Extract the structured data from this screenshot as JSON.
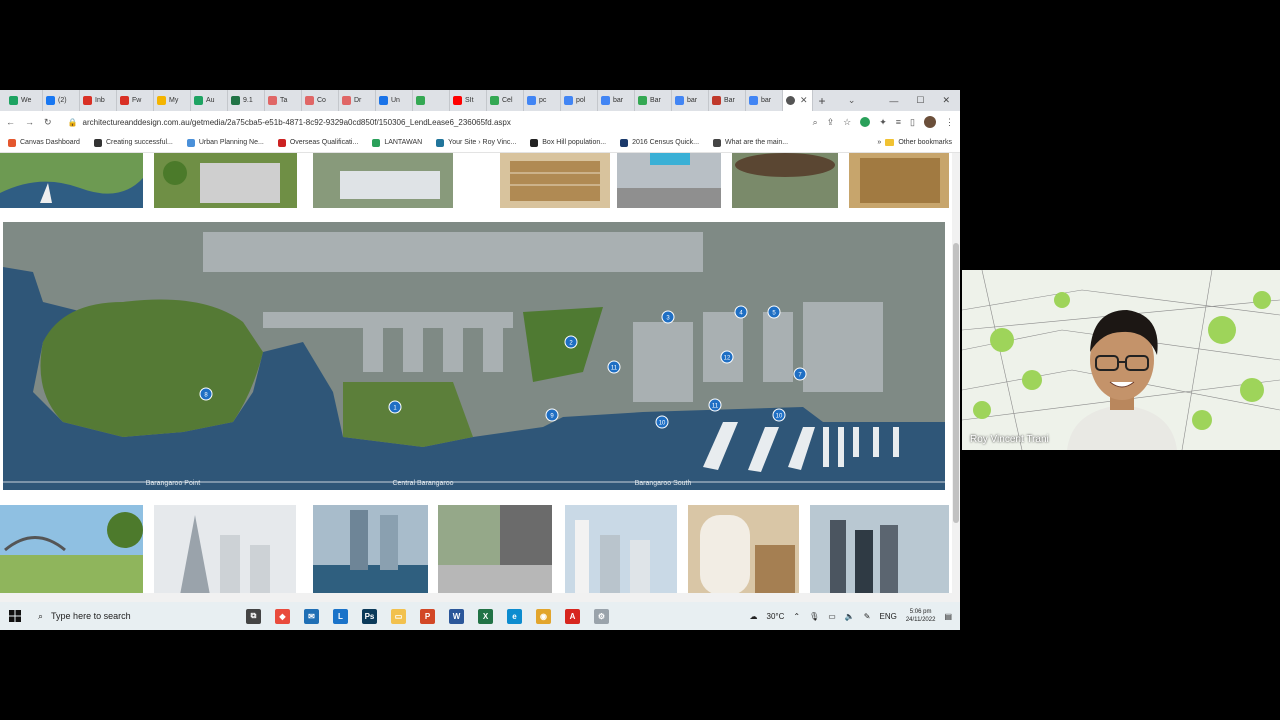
{
  "browser": {
    "tabs": [
      {
        "label": "We",
        "color": "#1ea362"
      },
      {
        "label": "(2)",
        "color": "#1877f2"
      },
      {
        "label": "Inb",
        "color": "#d93025"
      },
      {
        "label": "Fw",
        "color": "#d93025"
      },
      {
        "label": "My",
        "color": "#f4b400"
      },
      {
        "label": "Au",
        "color": "#1ea362"
      },
      {
        "label": "9.1",
        "color": "#217346"
      },
      {
        "label": "Ta",
        "color": "#e06666"
      },
      {
        "label": "Co",
        "color": "#e06666"
      },
      {
        "label": "Dr",
        "color": "#e06666"
      },
      {
        "label": "Un",
        "color": "#1a73e8"
      },
      {
        "label": "",
        "color": "#34a853"
      },
      {
        "label": "SIt",
        "color": "#ff0000"
      },
      {
        "label": "Cel",
        "color": "#34a853"
      },
      {
        "label": "pc",
        "color": "#4285f4"
      },
      {
        "label": "pol",
        "color": "#4285f4"
      },
      {
        "label": "bar",
        "color": "#4285f4"
      },
      {
        "label": "Bar",
        "color": "#34a853"
      },
      {
        "label": "bar",
        "color": "#4285f4"
      },
      {
        "label": "Bar",
        "color": "#c0392b"
      },
      {
        "label": "bar",
        "color": "#4285f4"
      }
    ],
    "url": "architectureanddesign.com.au/getmedia/2a75cba5-e51b-4871-8c92-9329a0cd850f/150306_LendLease6_236065fd.aspx",
    "bookmarks": [
      {
        "label": "Canvas Dashboard",
        "color": "#e4572e"
      },
      {
        "label": "Creating successful...",
        "color": "#333333"
      },
      {
        "label": "Urban Planning Ne...",
        "color": "#4a90d9"
      },
      {
        "label": "Overseas Qualificati...",
        "color": "#cc2222"
      },
      {
        "label": "LANTAWAN",
        "color": "#2aa05a"
      },
      {
        "label": "Your Site › Roy Vinc...",
        "color": "#21759b"
      },
      {
        "label": "Box Hill population...",
        "color": "#222222"
      },
      {
        "label": "2016 Census Quick...",
        "color": "#1b3a6b"
      },
      {
        "label": "What are the main...",
        "color": "#444444"
      }
    ],
    "other_bookmarks": "Other bookmarks"
  },
  "map": {
    "labels": [
      "Barangaroo Point",
      "Central Barangaroo",
      "Barangaroo South"
    ],
    "markers": [
      "1",
      "2",
      "3",
      "4",
      "5",
      "6",
      "7",
      "8",
      "9",
      "10",
      "11",
      "12",
      "10",
      "11"
    ]
  },
  "taskbar": {
    "search_placeholder": "Type here to search",
    "weather": "30°C",
    "lang": "ENG",
    "time": "5:06 pm",
    "date": "24/11/2022"
  },
  "webcam": {
    "name": "Roy Vincent Trani"
  }
}
